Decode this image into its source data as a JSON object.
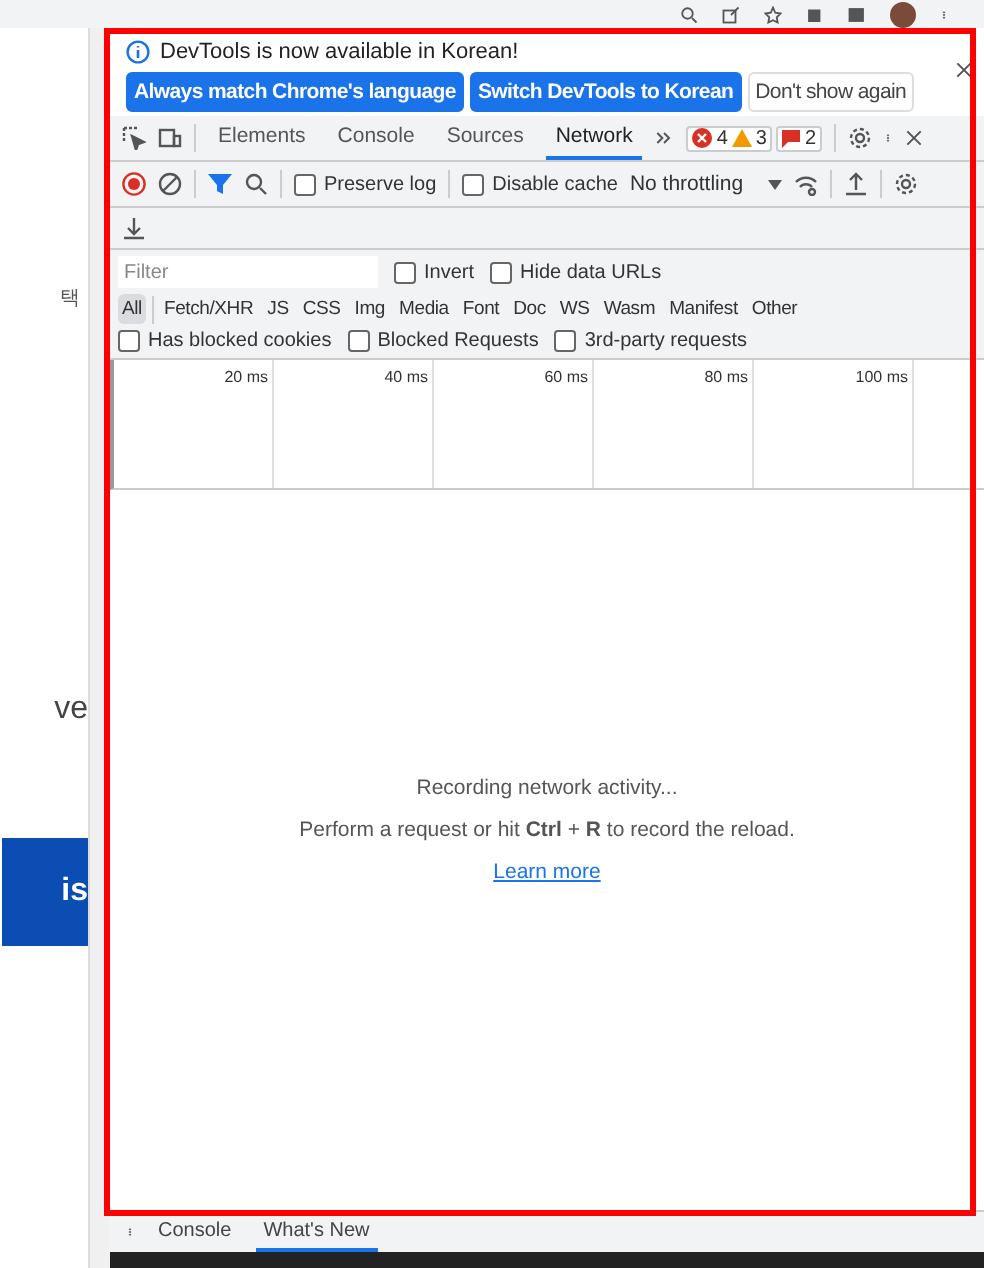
{
  "page": {
    "side_char": "택",
    "side_text": "ve",
    "side_button": "is"
  },
  "notice": {
    "text": "DevTools is now available in Korean!",
    "buttons": [
      {
        "label": "Always match Chrome's language",
        "primary": true
      },
      {
        "label": "Switch DevTools to Korean",
        "primary": true
      },
      {
        "label": "Don't show again",
        "primary": false
      }
    ]
  },
  "tabs": [
    {
      "label": "Elements",
      "selected": false
    },
    {
      "label": "Console",
      "selected": false
    },
    {
      "label": "Sources",
      "selected": false
    },
    {
      "label": "Network",
      "selected": true
    }
  ],
  "counters": {
    "errors": "4",
    "warnings": "3",
    "issues": "2"
  },
  "toolbar": {
    "checkboxes": [
      {
        "label": "Preserve log",
        "checked": false
      },
      {
        "label": "Disable cache",
        "checked": false
      }
    ],
    "throttling": "No throttling"
  },
  "filter": {
    "placeholder": "Filter",
    "checkboxes": [
      {
        "label": "Invert",
        "checked": false
      },
      {
        "label": "Hide data URLs",
        "checked": false
      }
    ]
  },
  "types": [
    {
      "label": "All",
      "selected": true
    },
    {
      "label": "Fetch/XHR",
      "selected": false
    },
    {
      "label": "JS",
      "selected": false
    },
    {
      "label": "CSS",
      "selected": false
    },
    {
      "label": "Img",
      "selected": false
    },
    {
      "label": "Media",
      "selected": false
    },
    {
      "label": "Font",
      "selected": false
    },
    {
      "label": "Doc",
      "selected": false
    },
    {
      "label": "WS",
      "selected": false
    },
    {
      "label": "Wasm",
      "selected": false
    },
    {
      "label": "Manifest",
      "selected": false
    },
    {
      "label": "Other",
      "selected": false
    }
  ],
  "request_filters": [
    {
      "label": "Has blocked cookies",
      "checked": false
    },
    {
      "label": "Blocked Requests",
      "checked": false
    },
    {
      "label": "3rd-party requests",
      "checked": false
    }
  ],
  "timeline": {
    "ticks": [
      "20 ms",
      "40 ms",
      "60 ms",
      "80 ms",
      "100 ms"
    ]
  },
  "empty_state": {
    "title": "Recording network activity...",
    "hint": "Perform a request or hit **Ctrl** + **R** to record the reload.",
    "link": "Learn more"
  },
  "drawer": {
    "tabs": [
      {
        "label": "Console",
        "selected": false
      },
      {
        "label": "What's New",
        "selected": true
      }
    ]
  }
}
